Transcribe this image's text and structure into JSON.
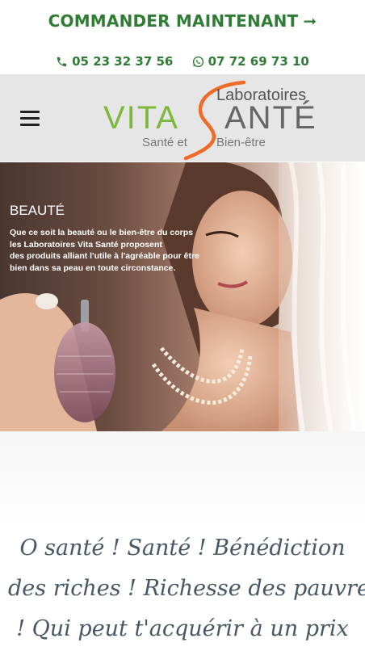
{
  "topbar": {
    "order_label": "COMMANDER MAINTENANT",
    "order_arrow": "➞",
    "phone_label": "05 23 32 37 56",
    "whatsapp_label": "07 72 69 73 10"
  },
  "header": {
    "logo": {
      "laboratoires": "Laboratoires",
      "vita": "VITA",
      "sante": "ANTÉ",
      "tagline_left": "Santé et",
      "tagline_right": "Bien-être"
    }
  },
  "hero": {
    "title": "BEAUTÉ",
    "lines": [
      "Que ce soit la beauté ou le bien-être du corps",
      "les Laboratoires Vita Santé proposent",
      "des produits alliant l'utile à l'agréable pour être",
      "bien dans sa peau en toute circonstance."
    ]
  },
  "quote": {
    "lines": [
      "O santé ! Santé ! Bénédiction",
      "des riches ! Richesse des pauvres",
      "! Qui peut t'acquérir à un prix"
    ]
  },
  "colors": {
    "accent_green": "#2f7d34",
    "logo_green": "#7cb83a",
    "logo_orange": "#f06a28",
    "quote_text": "#475766"
  },
  "icons": [
    "phone-icon",
    "whatsapp-icon",
    "menu-icon",
    "arrow-right-icon"
  ]
}
